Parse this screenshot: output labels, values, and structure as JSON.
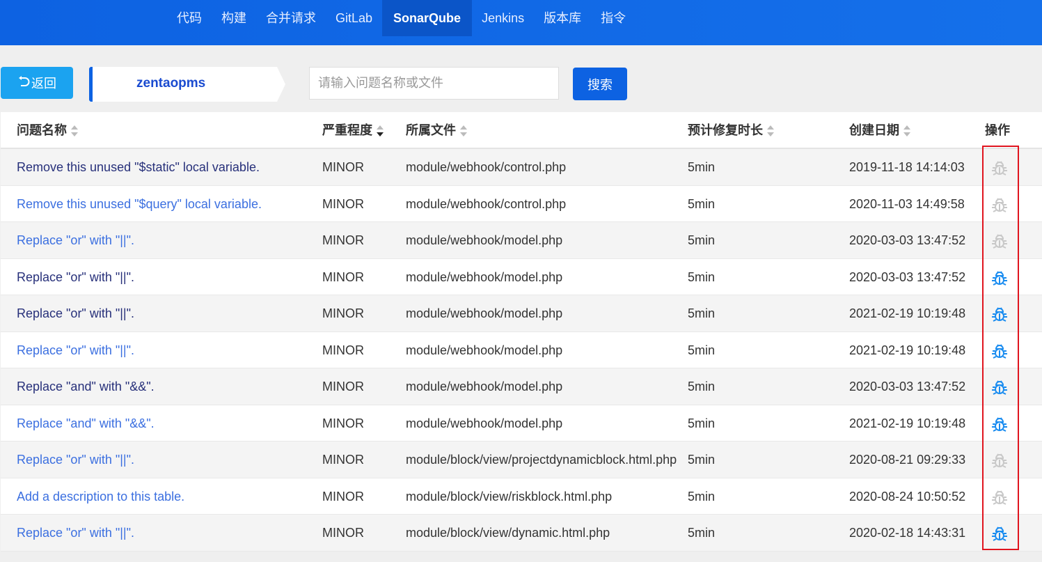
{
  "nav": {
    "tabs": [
      "代码",
      "构建",
      "合并请求",
      "GitLab",
      "SonarQube",
      "Jenkins",
      "版本库",
      "指令"
    ],
    "active": "SonarQube"
  },
  "toolbar": {
    "back_label": "返回",
    "project": "zentaopms",
    "search_placeholder": "请输入问题名称或文件",
    "search_value": "",
    "search_label": "搜索"
  },
  "colors": {
    "link": "#3b6fe0",
    "visited": "#27307a",
    "bug_active": "#1a8cf0",
    "bug_inactive": "#c8c8c8"
  },
  "table": {
    "headers": [
      "问题名称",
      "严重程度",
      "所属文件",
      "预计修复时长",
      "创建日期",
      "操作"
    ],
    "rows": [
      {
        "name": "Remove this unused \"$static\" local variable.",
        "severity": "MINOR",
        "file": "module/webhook/control.php",
        "effort": "5min",
        "date": "2019-11-18 14:14:03",
        "visited": true,
        "bug": false
      },
      {
        "name": "Remove this unused \"$query\" local variable.",
        "severity": "MINOR",
        "file": "module/webhook/control.php",
        "effort": "5min",
        "date": "2020-11-03 14:49:58",
        "visited": false,
        "bug": false
      },
      {
        "name": "Replace \"or\" with \"||\".",
        "severity": "MINOR",
        "file": "module/webhook/model.php",
        "effort": "5min",
        "date": "2020-03-03 13:47:52",
        "visited": false,
        "bug": false
      },
      {
        "name": "Replace \"or\" with \"||\".",
        "severity": "MINOR",
        "file": "module/webhook/model.php",
        "effort": "5min",
        "date": "2020-03-03 13:47:52",
        "visited": true,
        "bug": true
      },
      {
        "name": "Replace \"or\" with \"||\".",
        "severity": "MINOR",
        "file": "module/webhook/model.php",
        "effort": "5min",
        "date": "2021-02-19 10:19:48",
        "visited": true,
        "bug": true
      },
      {
        "name": "Replace \"or\" with \"||\".",
        "severity": "MINOR",
        "file": "module/webhook/model.php",
        "effort": "5min",
        "date": "2021-02-19 10:19:48",
        "visited": false,
        "bug": true
      },
      {
        "name": "Replace \"and\" with \"&&\".",
        "severity": "MINOR",
        "file": "module/webhook/model.php",
        "effort": "5min",
        "date": "2020-03-03 13:47:52",
        "visited": true,
        "bug": true
      },
      {
        "name": "Replace \"and\" with \"&&\".",
        "severity": "MINOR",
        "file": "module/webhook/model.php",
        "effort": "5min",
        "date": "2021-02-19 10:19:48",
        "visited": false,
        "bug": true
      },
      {
        "name": "Replace \"or\" with \"||\".",
        "severity": "MINOR",
        "file": "module/block/view/projectdynamicblock.html.php",
        "effort": "5min",
        "date": "2020-08-21 09:29:33",
        "visited": false,
        "bug": false
      },
      {
        "name": "Add a description to this table.",
        "severity": "MINOR",
        "file": "module/block/view/riskblock.html.php",
        "effort": "5min",
        "date": "2020-08-24 10:50:52",
        "visited": false,
        "bug": false
      },
      {
        "name": "Replace \"or\" with \"||\".",
        "severity": "MINOR",
        "file": "module/block/view/dynamic.html.php",
        "effort": "5min",
        "date": "2020-02-18 14:43:31",
        "visited": false,
        "bug": true
      }
    ]
  }
}
